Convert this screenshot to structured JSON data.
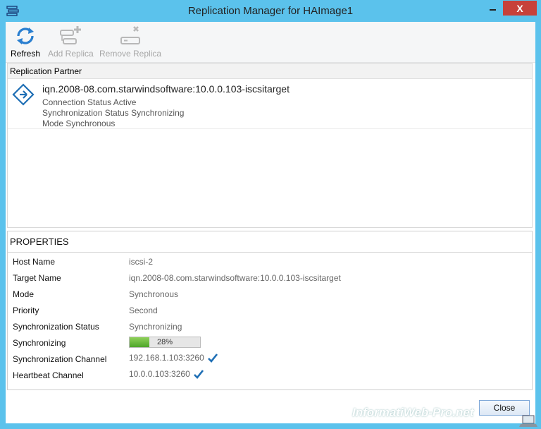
{
  "window": {
    "title": "Replication Manager for HAImage1",
    "close_glyph": "X"
  },
  "toolbar": {
    "refresh_label": "Refresh",
    "add_label": "Add Replica",
    "remove_label": "Remove Replica",
    "refresh_icon": "refresh-icon",
    "add_icon": "add-replica-icon",
    "remove_icon": "remove-replica-icon"
  },
  "replication_partner": {
    "header": "Replication Partner",
    "name": "iqn.2008-08.com.starwindsoftware:10.0.0.103-iscsitarget",
    "connection_status": "Connection Status Active",
    "sync_status": "Synchronization Status Synchronizing",
    "mode": "Mode Synchronous"
  },
  "properties": {
    "title": "PROPERTIES",
    "rows": [
      {
        "label": "Host Name",
        "value": "iscsi-2"
      },
      {
        "label": "Target Name",
        "value": "iqn.2008-08.com.starwindsoftware:10.0.0.103-iscsitarget"
      },
      {
        "label": "Mode",
        "value": "Synchronous"
      },
      {
        "label": "Priority",
        "value": "Second"
      },
      {
        "label": "Synchronization Status",
        "value": "Synchronizing"
      },
      {
        "label": "Synchronizing",
        "value": "28%"
      },
      {
        "label": "Synchronization Channel",
        "value": "192.168.1.103:3260"
      },
      {
        "label": "Heartbeat Channel",
        "value": "10.0.0.103:3260"
      }
    ],
    "progress_fraction": 0.28
  },
  "footer": {
    "close_label": "Close"
  },
  "watermark": "InformatiWeb-Pro.net",
  "colors": {
    "titlebar": "#5bc2ec",
    "close_button": "#c7413a",
    "accent": "#1f6fb5",
    "progress_fill": "#5fb532"
  }
}
